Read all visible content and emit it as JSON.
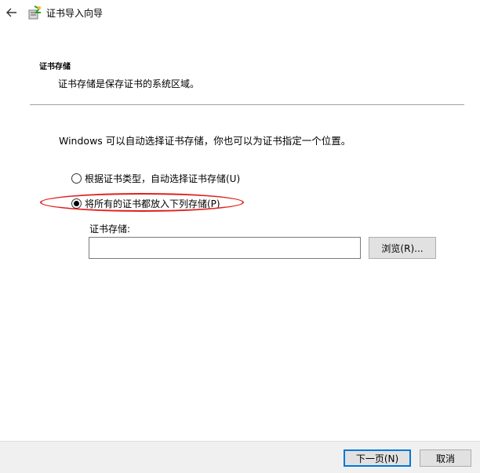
{
  "window": {
    "title": "证书导入向导",
    "back_icon": "arrow-left-icon",
    "app_icon": "certificate-wizard-icon"
  },
  "header": {
    "title": "证书存储",
    "description": "证书存储是保存证书的系统区域。"
  },
  "body": {
    "intro": "Windows 可以自动选择证书存储，你也可以为证书指定一个位置。",
    "options": [
      {
        "label": "根据证书类型，自动选择证书存储(U)",
        "checked": false
      },
      {
        "label": "将所有的证书都放入下列存储(P)",
        "checked": true
      }
    ],
    "store_label": "证书存储:",
    "store_value": "",
    "browse_label": "浏览(R)..."
  },
  "footer": {
    "next_label": "下一页(N)",
    "cancel_label": "取消"
  },
  "colors": {
    "highlight": "#e0201d",
    "default_button_border": "#0078d7"
  }
}
